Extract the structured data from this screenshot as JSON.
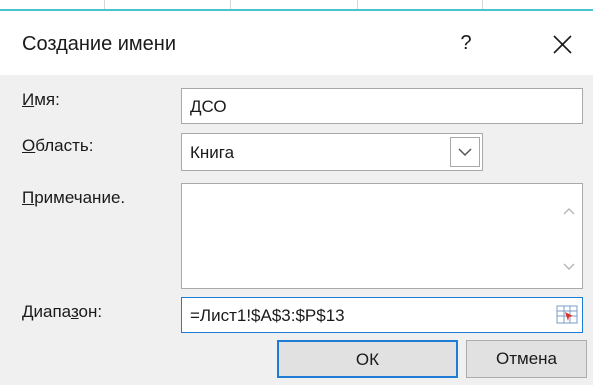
{
  "window": {
    "title": "Создание имени",
    "help_label": "?",
    "close_icon": "close-icon"
  },
  "form": {
    "name": {
      "label_underlined": "И",
      "label_rest": "мя:",
      "value": "ДСО"
    },
    "scope": {
      "label_underlined": "О",
      "label_rest": "бласть:",
      "value": "Книга",
      "dropdown_icon": "chevron-down-icon"
    },
    "comment": {
      "label_underlined": "П",
      "label_rest": "римечание.",
      "value": ""
    },
    "range": {
      "label_before": "Диапа",
      "label_underlined": "з",
      "label_after": "он:",
      "value": "=Лист1!$A$3:$P$13",
      "picker_icon": "range-select-icon"
    }
  },
  "buttons": {
    "ok": "ОК",
    "cancel": "Отмена"
  },
  "colors": {
    "focus_border": "#1e7bd6",
    "dialog_bg": "#f0f0f0",
    "accent_strip": "#4cc3c8"
  }
}
